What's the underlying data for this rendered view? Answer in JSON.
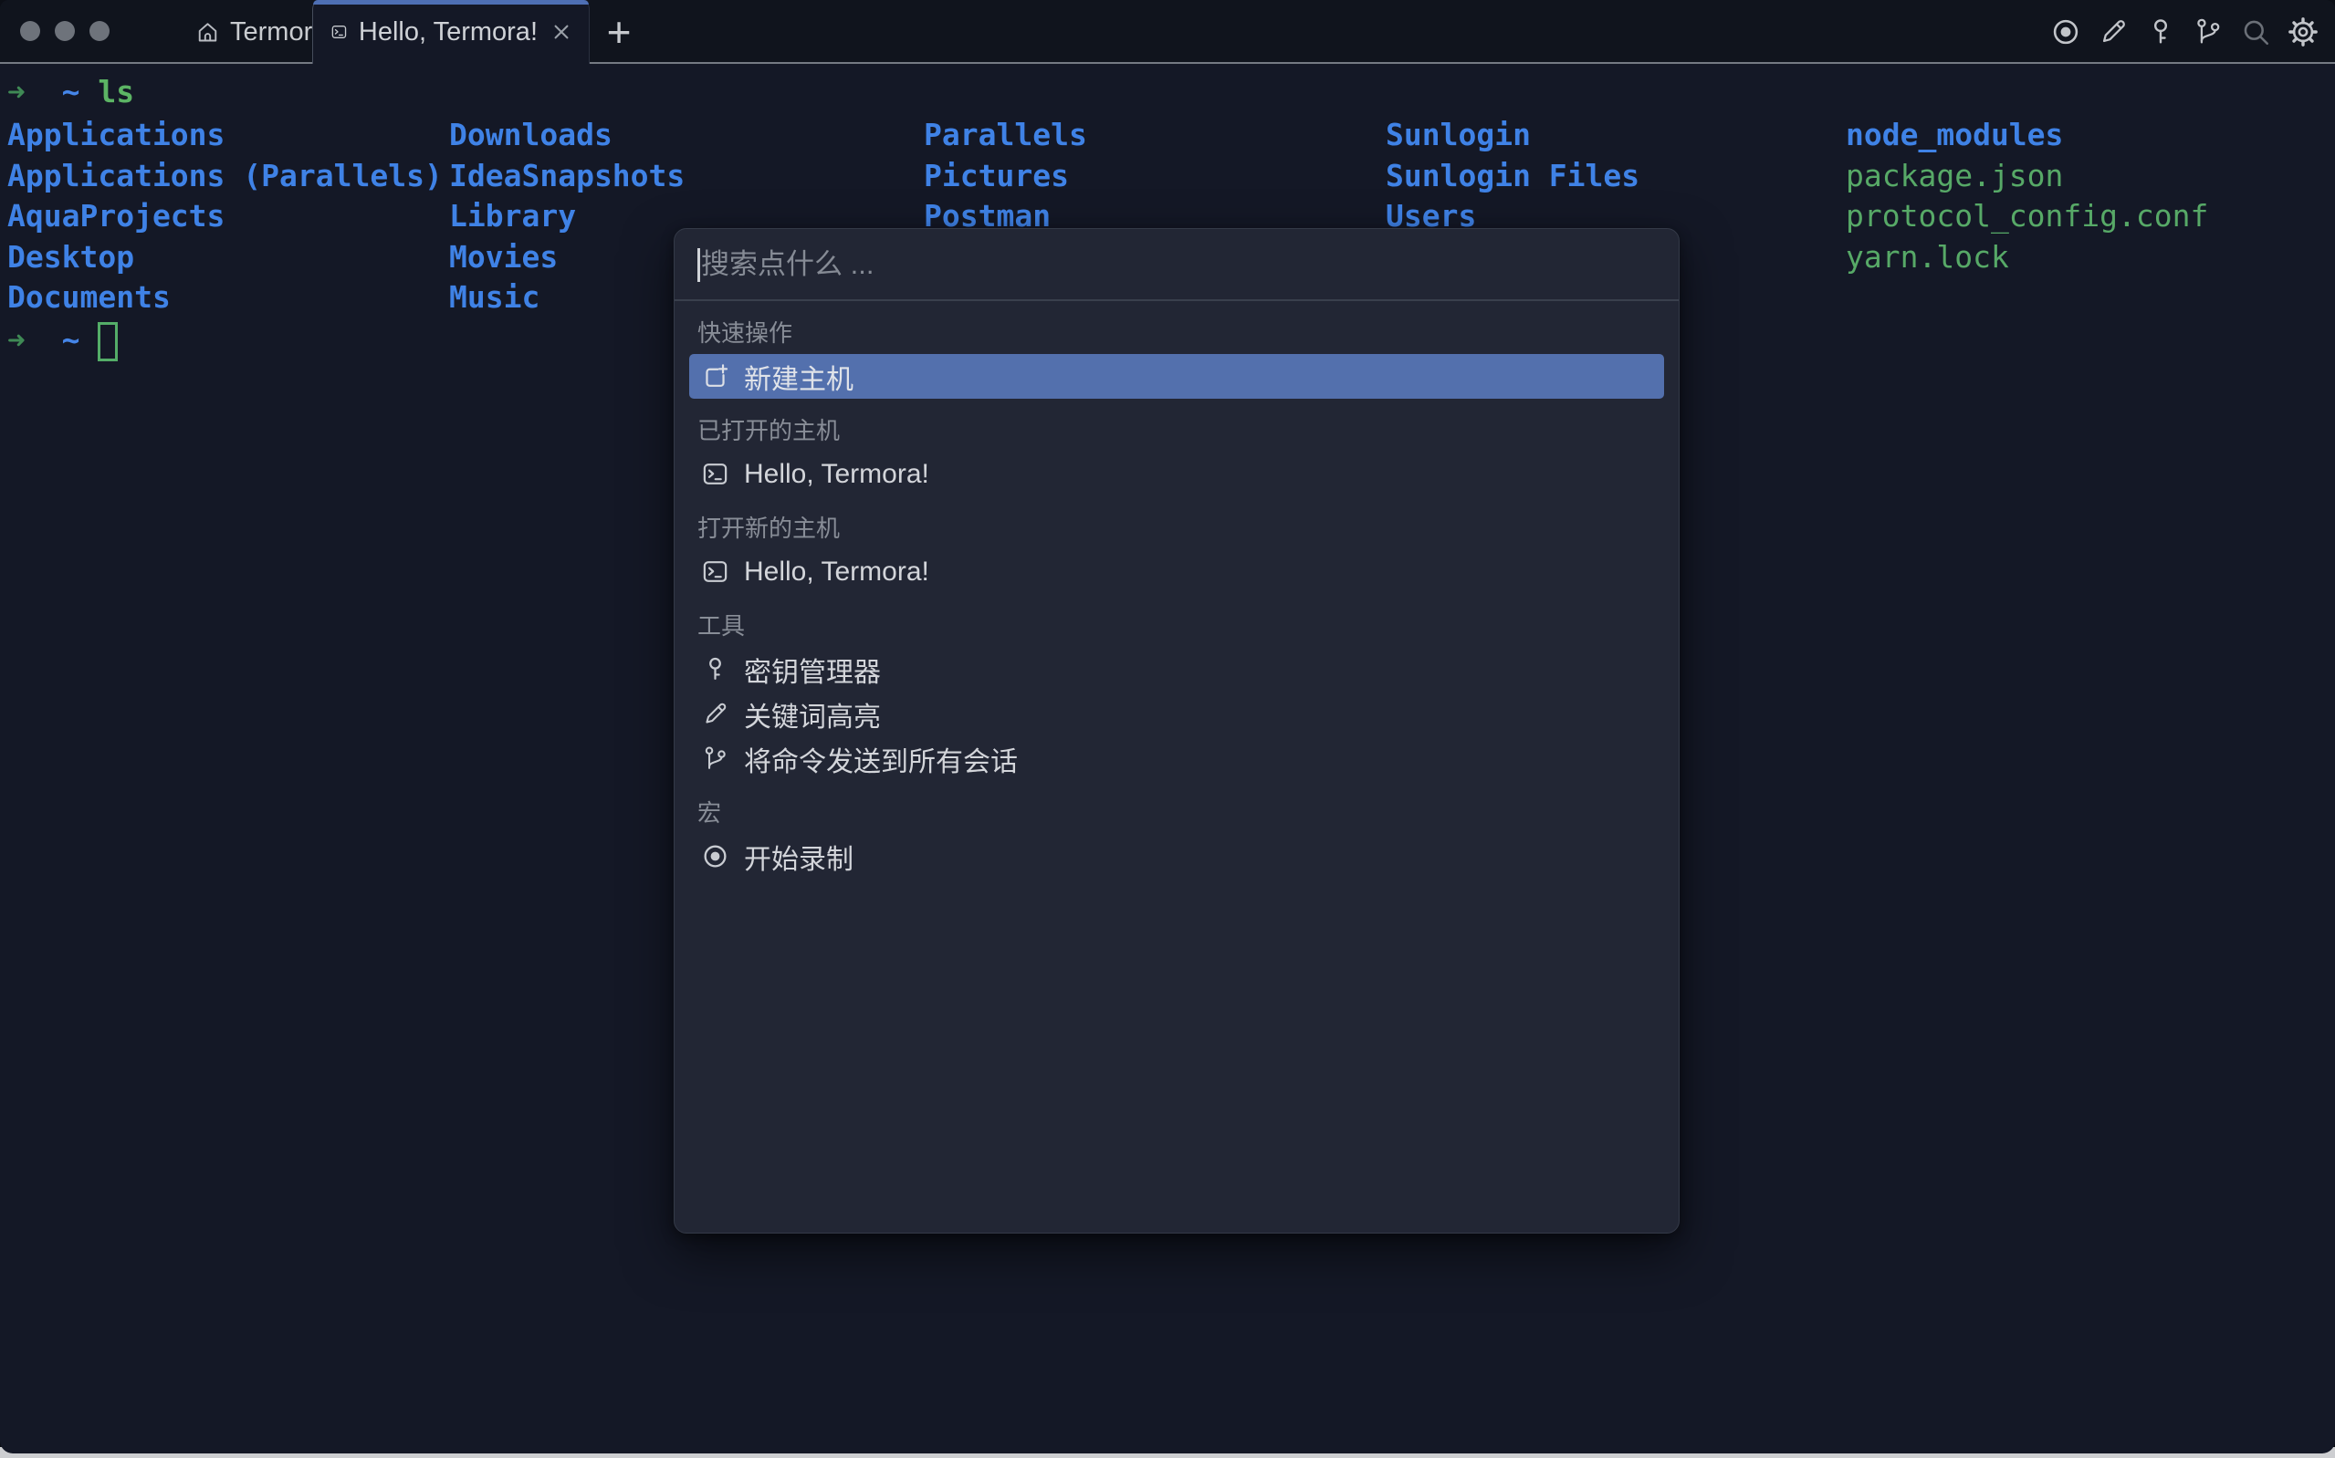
{
  "colors": {
    "terminal_bg": "#141826",
    "titlebar_bg": "#10141d",
    "palette_bg": "#222634",
    "selection_blue": "#5370ad",
    "tab_accent_blue": "#4e6fb4",
    "dir_blue": "#3f82e6",
    "file_green": "#57a967",
    "prompt_green": "#3f8a55",
    "cursor_green": "#54ad68",
    "desktop_strip": "#cdced1"
  },
  "titlebar": {
    "app": {
      "label": "Termora"
    },
    "tab": {
      "title": "Hello, Termora!"
    },
    "new_tab_glyph": "+",
    "actions": [
      "record-macro",
      "keyword-highlight",
      "key-manager",
      "send-to-all-sessions",
      "search",
      "settings"
    ]
  },
  "terminal": {
    "prompt": {
      "symbol": "➜",
      "cwd": "~"
    },
    "command": "ls",
    "columns": [
      {
        "entries": [
          {
            "name": "Applications",
            "type": "dir"
          },
          {
            "name": "Applications (Parallels)",
            "type": "dir"
          },
          {
            "name": "AquaProjects",
            "type": "dir"
          },
          {
            "name": "Desktop",
            "type": "dir"
          },
          {
            "name": "Documents",
            "type": "dir"
          }
        ]
      },
      {
        "entries": [
          {
            "name": "Downloads",
            "type": "dir"
          },
          {
            "name": "IdeaSnapshots",
            "type": "dir"
          },
          {
            "name": "Library",
            "type": "dir"
          },
          {
            "name": "Movies",
            "type": "dir"
          },
          {
            "name": "Music",
            "type": "dir"
          }
        ]
      },
      {
        "entries": [
          {
            "name": "Parallels",
            "type": "dir"
          },
          {
            "name": "Pictures",
            "type": "dir"
          },
          {
            "name": "Postman",
            "type": "dir"
          }
        ]
      },
      {
        "entries": [
          {
            "name": "Sunlogin",
            "type": "dir"
          },
          {
            "name": "Sunlogin Files",
            "type": "dir"
          },
          {
            "name": "Users",
            "type": "dir"
          }
        ]
      },
      {
        "entries": [
          {
            "name": "node_modules",
            "type": "dir"
          },
          {
            "name": "package.json",
            "type": "file"
          },
          {
            "name": "protocol_config.conf",
            "type": "file"
          },
          {
            "name": "yarn.lock",
            "type": "file"
          }
        ]
      }
    ]
  },
  "palette": {
    "search_placeholder": "搜索点什么 ...",
    "sections": [
      {
        "title": "快速操作",
        "items": [
          {
            "label": "新建主机",
            "icon": "new-host-icon",
            "selected": true
          }
        ]
      },
      {
        "title": "已打开的主机",
        "items": [
          {
            "label": "Hello, Termora!",
            "icon": "terminal-icon"
          }
        ]
      },
      {
        "title": "打开新的主机",
        "items": [
          {
            "label": "Hello, Termora!",
            "icon": "terminal-icon"
          }
        ]
      },
      {
        "title": "工具",
        "items": [
          {
            "label": "密钥管理器",
            "icon": "key-icon"
          },
          {
            "label": "关键词高亮",
            "icon": "pencil-icon"
          },
          {
            "label": "将命令发送到所有会话",
            "icon": "git-branch-icon"
          }
        ]
      },
      {
        "title": "宏",
        "items": [
          {
            "label": "开始录制",
            "icon": "record-icon"
          }
        ]
      }
    ]
  }
}
